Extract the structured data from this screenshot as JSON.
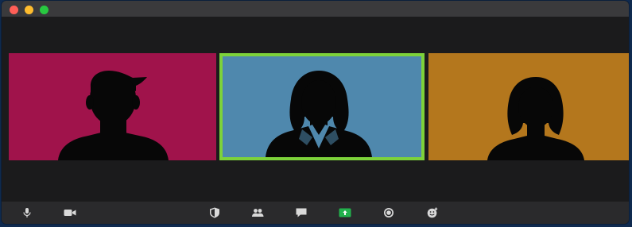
{
  "window": {
    "traffic_lights": {
      "close_color": "#ff5f57",
      "minimize_color": "#febc2e",
      "maximize_color": "#28c840"
    }
  },
  "participants": [
    {
      "tile_color": "#a0134b",
      "silhouette": "man-short-hair",
      "active_speaker": false
    },
    {
      "tile_color": "#4f88ad",
      "silhouette": "woman-bob-hair-suit",
      "active_speaker": true
    },
    {
      "tile_color": "#b4771d",
      "silhouette": "woman-bob-hair",
      "active_speaker": false
    }
  ],
  "active_speaker_border_color": "#7dd23a",
  "toolbar": {
    "icons": [
      "microphone-icon",
      "video-camera-icon",
      "security-shield-icon",
      "participants-icon",
      "chat-icon",
      "share-screen-icon",
      "record-icon",
      "reactions-icon"
    ],
    "share_screen_color": "#22b14c"
  }
}
